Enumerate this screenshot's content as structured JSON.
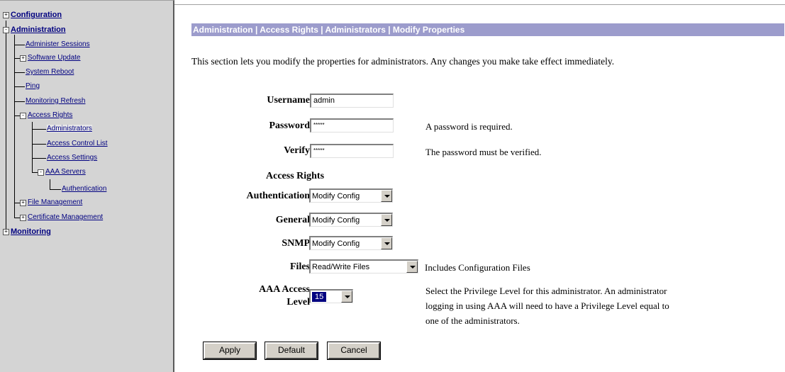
{
  "sidebar": {
    "items": [
      {
        "label": "Configuration",
        "expander": "+"
      },
      {
        "label": "Administration",
        "expander": "-"
      },
      {
        "label": "Administer Sessions"
      },
      {
        "label": "Software Update",
        "expander": "+"
      },
      {
        "label": "System Reboot"
      },
      {
        "label": "Ping"
      },
      {
        "label": "Monitoring Refresh"
      },
      {
        "label": "Access Rights",
        "expander": "-"
      },
      {
        "label": "Administrators"
      },
      {
        "label": "Access Control List"
      },
      {
        "label": "Access Settings"
      },
      {
        "label": "AAA Servers",
        "expander": "-"
      },
      {
        "label": "Authentication"
      },
      {
        "label": "File Management",
        "expander": "+"
      },
      {
        "label": "Certificate Management",
        "expander": "+"
      },
      {
        "label": "Monitoring",
        "expander": "+"
      }
    ]
  },
  "header": {
    "breadcrumb": "Administration | Access Rights | Administrators | Modify Properties"
  },
  "main": {
    "intro": "This section lets you modify the properties for administrators. Any changes you make take effect immediately.",
    "username": {
      "label": "Username",
      "value": "admin"
    },
    "password": {
      "label": "Password",
      "value": "*****",
      "note": "A password is required."
    },
    "verify": {
      "label": "Verify",
      "value": "*****",
      "note": "The password must be verified."
    },
    "access_rights_heading": "Access Rights",
    "authentication": {
      "label": "Authentication",
      "value": "Modify Config"
    },
    "general": {
      "label": "General",
      "value": "Modify Config"
    },
    "snmp": {
      "label": "SNMP",
      "value": "Modify Config"
    },
    "files": {
      "label": "Files",
      "value": "Read/Write Files",
      "note": "Includes Configuration Files"
    },
    "aaa": {
      "label_line1": "AAA Access",
      "label_line2": "Level",
      "value": "15",
      "note_lines": [
        "Select the Privilege Level for this administrator. An administrator",
        "logging in using AAA will need to have a Privilege Level equal to",
        "one of the administrators."
      ]
    }
  },
  "buttons": {
    "apply": "Apply",
    "default": "Default",
    "cancel": "Cancel"
  },
  "colors": {
    "breadcrumb_bg": "#9c9ccc",
    "sidebar_bg": "#d4d4d4",
    "link": "#0000c0"
  }
}
